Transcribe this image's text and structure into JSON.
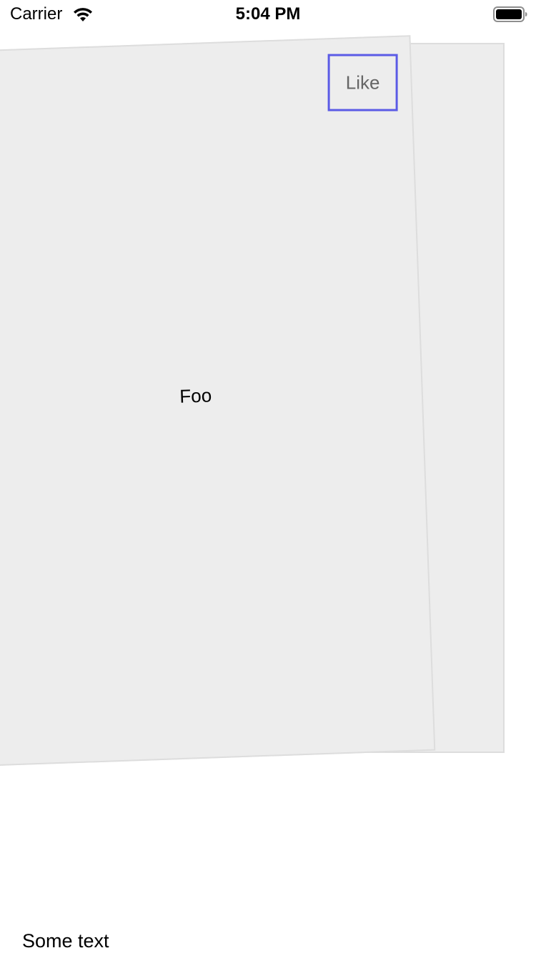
{
  "status_bar": {
    "carrier": "Carrier",
    "time": "5:04 PM",
    "icons": [
      "wifi-icon",
      "battery-icon"
    ]
  },
  "cards": {
    "front": {
      "text": "Foo",
      "like_label": "Like"
    }
  },
  "footer": {
    "text": "Some text"
  },
  "colors": {
    "card_background": "#ededed",
    "card_border": "#dddddd",
    "like_border": "#5b5be6",
    "like_text": "#666666"
  }
}
